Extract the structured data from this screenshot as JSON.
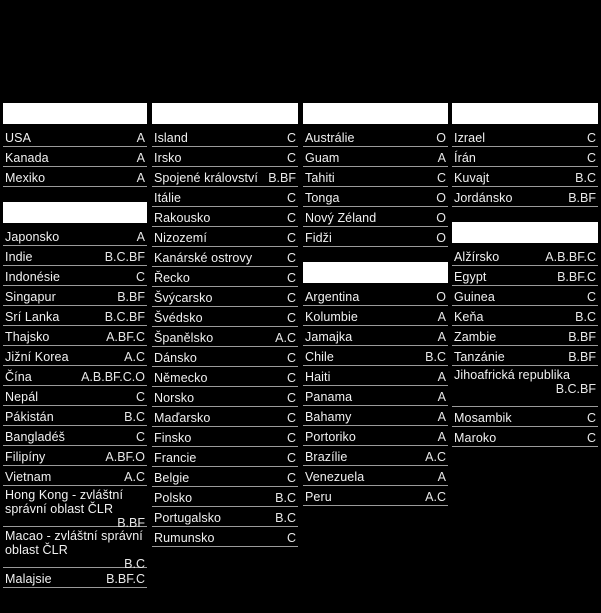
{
  "page": {
    "background_color": "#000000",
    "text_color": "#ffffff",
    "rule_color": "#9a9a9a",
    "header_box_color": "#ffffff"
  },
  "columns": [
    {
      "id": "column-1",
      "groups": [
        {
          "id": "group-north-america",
          "header": "",
          "rows": [
            {
              "name": "USA",
              "code": "A"
            },
            {
              "name": "Kanada",
              "code": "A"
            },
            {
              "name": "Mexiko",
              "code": "A"
            }
          ]
        },
        {
          "id": "group-asia",
          "header": "",
          "rows": [
            {
              "name": "Japonsko",
              "code": "A"
            },
            {
              "name": "Indie",
              "code": "B.C.BF"
            },
            {
              "name": "Indonésie",
              "code": "C"
            },
            {
              "name": "Singapur",
              "code": "B.BF"
            },
            {
              "name": "Srí Lanka",
              "code": "B.C.BF"
            },
            {
              "name": "Thajsko",
              "code": "A.BF.C"
            },
            {
              "name": "Jižní Korea",
              "code": "A.C"
            },
            {
              "name": "Čína",
              "code": "A.B.BF.C.O"
            },
            {
              "name": "Nepál",
              "code": "C"
            },
            {
              "name": "Pákistán",
              "code": "B.C"
            },
            {
              "name": "Bangladéš",
              "code": "C"
            },
            {
              "name": "Filipíny",
              "code": "A.BF.O"
            },
            {
              "name": "Vietnam",
              "code": "A.C"
            },
            {
              "name": "Hong Kong - zvláštní správní oblast ČLR",
              "code": "B.BF",
              "stacked": true
            },
            {
              "name": "Macao - zvláštní správní oblast ČLR",
              "code": "B.C",
              "stacked": true
            },
            {
              "name": "Malajsie",
              "code": "B.BF.C"
            }
          ]
        }
      ]
    },
    {
      "id": "column-2",
      "groups": [
        {
          "id": "group-europe",
          "header": "",
          "rows": [
            {
              "name": "Island",
              "code": "C"
            },
            {
              "name": "Irsko",
              "code": "C"
            },
            {
              "name": "Spojené království",
              "code": "B.BF"
            },
            {
              "name": "Itálie",
              "code": "C"
            },
            {
              "name": "Rakousko",
              "code": "C"
            },
            {
              "name": "Nizozemí",
              "code": "C"
            },
            {
              "name": "Kanárské ostrovy",
              "code": "C"
            },
            {
              "name": "Řecko",
              "code": "C"
            },
            {
              "name": "Švýcarsko",
              "code": "C"
            },
            {
              "name": "Švédsko",
              "code": "C"
            },
            {
              "name": "Španělsko",
              "code": "A.C"
            },
            {
              "name": "Dánsko",
              "code": "C"
            },
            {
              "name": "Německo",
              "code": "C"
            },
            {
              "name": "Norsko",
              "code": "C"
            },
            {
              "name": "Maďarsko",
              "code": "C"
            },
            {
              "name": "Finsko",
              "code": "C"
            },
            {
              "name": "Francie",
              "code": "C"
            },
            {
              "name": "Belgie",
              "code": "C"
            },
            {
              "name": "Polsko",
              "code": "B.C"
            },
            {
              "name": "Portugalsko",
              "code": "B.C"
            },
            {
              "name": "Rumunsko",
              "code": "C"
            }
          ]
        }
      ]
    },
    {
      "id": "column-3",
      "groups": [
        {
          "id": "group-oceania",
          "header": "",
          "rows": [
            {
              "name": "Austrálie",
              "code": "O"
            },
            {
              "name": "Guam",
              "code": "A"
            },
            {
              "name": "Tahiti",
              "code": "C"
            },
            {
              "name": "Tonga",
              "code": "O"
            },
            {
              "name": "Nový Zéland",
              "code": "O"
            },
            {
              "name": "Fidži",
              "code": "O"
            }
          ]
        },
        {
          "id": "group-latin-america",
          "header": "",
          "rows": [
            {
              "name": "Argentina",
              "code": "O"
            },
            {
              "name": "Kolumbie",
              "code": "A"
            },
            {
              "name": "Jamajka",
              "code": "A"
            },
            {
              "name": "Chile",
              "code": "B.C"
            },
            {
              "name": "Haiti",
              "code": "A"
            },
            {
              "name": "Panama",
              "code": "A"
            },
            {
              "name": "Bahamy",
              "code": "A"
            },
            {
              "name": "Portoriko",
              "code": "A"
            },
            {
              "name": "Brazílie",
              "code": "A.C"
            },
            {
              "name": "Venezuela",
              "code": "A"
            },
            {
              "name": "Peru",
              "code": "A.C"
            }
          ]
        }
      ]
    },
    {
      "id": "column-4",
      "groups": [
        {
          "id": "group-middle-east",
          "header": "",
          "rows": [
            {
              "name": "Izrael",
              "code": "C"
            },
            {
              "name": "Írán",
              "code": "C"
            },
            {
              "name": "Kuvajt",
              "code": "B.C"
            },
            {
              "name": "Jordánsko",
              "code": "B.BF"
            }
          ]
        },
        {
          "id": "group-africa",
          "header": "",
          "rows": [
            {
              "name": "Alžírsko",
              "code": "A.B.BF.C"
            },
            {
              "name": "Egypt",
              "code": "B.BF.C"
            },
            {
              "name": "Guinea",
              "code": "C"
            },
            {
              "name": "Keňa",
              "code": "B.C"
            },
            {
              "name": "Zambie",
              "code": "B.BF"
            },
            {
              "name": "Tanzánie",
              "code": "B.BF"
            },
            {
              "name": "Jihoafrická republika",
              "code": "B.C.BF",
              "stacked": true
            },
            {
              "name": "Mosambik",
              "code": "C"
            },
            {
              "name": "Maroko",
              "code": "C"
            }
          ]
        }
      ]
    }
  ]
}
